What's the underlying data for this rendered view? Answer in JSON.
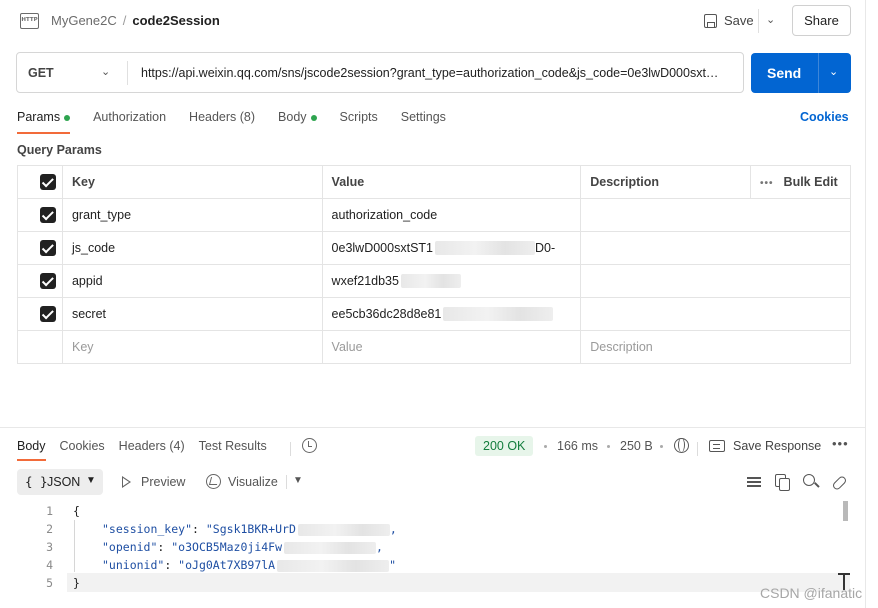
{
  "header": {
    "protocol_badge": "HTTP",
    "workspace": "MyGene2C",
    "separator": "/",
    "request_name": "code2Session",
    "save_label": "Save",
    "share_label": "Share"
  },
  "request": {
    "method": "GET",
    "url": "https://api.weixin.qq.com/sns/jscode2session?grant_type=authorization_code&js_code=0e3lwD000sxt…",
    "send_label": "Send"
  },
  "tabs": {
    "items": [
      {
        "label": "Params",
        "dot": true,
        "active": true
      },
      {
        "label": "Authorization",
        "dot": false,
        "active": false
      },
      {
        "label": "Headers (8)",
        "dot": false,
        "active": false
      },
      {
        "label": "Body",
        "dot": true,
        "active": false
      },
      {
        "label": "Scripts",
        "dot": false,
        "active": false
      },
      {
        "label": "Settings",
        "dot": false,
        "active": false
      }
    ],
    "cookies_label": "Cookies"
  },
  "params": {
    "title": "Query Params",
    "columns": {
      "key": "Key",
      "value": "Value",
      "description": "Description",
      "bulk_edit": "Bulk Edit"
    },
    "rows": [
      {
        "key": "grant_type",
        "value": "authorization_code",
        "blur_width": 0
      },
      {
        "key": "js_code",
        "value": "0e3lwD000sxtST1",
        "blur_width": 100,
        "value_tail": "D0-"
      },
      {
        "key": "appid",
        "value": "wxef21db35",
        "blur_width": 60
      },
      {
        "key": "secret",
        "value": "ee5cb36dc28d8e81",
        "blur_width": 110
      }
    ],
    "placeholder": {
      "key": "Key",
      "value": "Value",
      "description": "Description"
    }
  },
  "response": {
    "tabs": [
      {
        "label": "Body",
        "active": true
      },
      {
        "label": "Cookies",
        "active": false
      },
      {
        "label": "Headers (4)",
        "active": false
      },
      {
        "label": "Test Results",
        "active": false
      }
    ],
    "status": "200 OK",
    "time": "166 ms",
    "size": "250 B",
    "save_response_label": "Save Response",
    "format": "JSON",
    "format_brackets": "{ }",
    "preview_label": "Preview",
    "visualize_label": "Visualize",
    "lines": [
      {
        "num": "1",
        "text": "{"
      },
      {
        "num": "2",
        "key": "\"session_key\"",
        "value": "\"Sgsk1BKR+UrD",
        "blur": 92,
        "trail": ","
      },
      {
        "num": "3",
        "key": "\"openid\"",
        "value": "\"o3OCB5Maz0ji4Fw",
        "blur": 92,
        "trail": ","
      },
      {
        "num": "4",
        "key": "\"unionid\"",
        "value": "\"oJg0At7XB97lA",
        "blur": 112,
        "trail": "\""
      },
      {
        "num": "5",
        "text": "}"
      }
    ]
  },
  "watermark": "CSDN @ifanatic",
  "icons": [
    "http-icon",
    "save-icon",
    "chevron-down-icon",
    "history-icon",
    "globe-icon",
    "save-response-icon",
    "more-icon",
    "play-icon",
    "visualize-icon",
    "wrap-lines-icon",
    "copy-icon",
    "search-icon",
    "link-icon"
  ]
}
